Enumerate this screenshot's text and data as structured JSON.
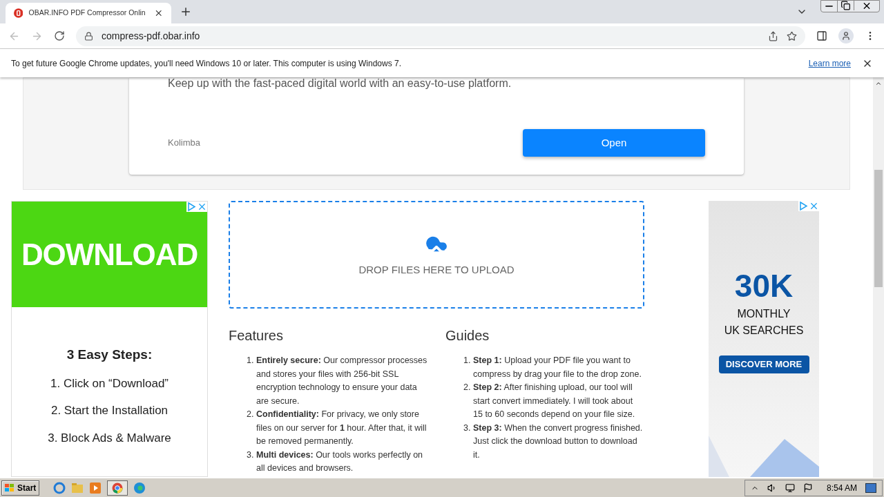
{
  "browser": {
    "tab": {
      "title": "OBAR.INFO PDF Compressor Onlin",
      "selected": true
    },
    "address": "compress-pdf.obar.info"
  },
  "infobar": {
    "message": "To get future Google Chrome updates, you'll need Windows 10 or later. This computer is using Windows 7.",
    "link": "Learn more"
  },
  "top_ad": {
    "text": "Keep up with the fast-paced digital world with an easy-to-use platform.",
    "brand": "Kolimba",
    "button": "Open"
  },
  "left_ad": {
    "headline": "DOWNLOAD",
    "subtitle": "3 Easy Steps:",
    "steps": [
      "1. Click on “Download”",
      "2. Start the Installation",
      "3. Block Ads & Malware"
    ]
  },
  "upload": {
    "label": "DROP FILES HERE TO UPLOAD"
  },
  "features": {
    "title": "Features",
    "items": [
      {
        "number": "1.",
        "text": "**Entirely secure:** Our compressor processes and stores your files with 256-bit SSL encryption technology to ensure your data are secure."
      },
      {
        "number": "2.",
        "text": "**Confidentiality:** For privacy, we only store files on our server for **1** hour. After that, it will be removed permanently."
      },
      {
        "number": "3.",
        "text": "**Multi devices:** Our tools works perfectly on all devices and browsers."
      }
    ]
  },
  "guides": {
    "title": "Guides",
    "items": [
      {
        "number": "1.",
        "text": "**Step 1:** Upload your PDF file you want to compress by drag your file to the drop zone."
      },
      {
        "number": "2.",
        "text": "**Step 2:** After finishing upload, our tool will start convert immediately. I will took about 15 to 60 seconds depend on your file size."
      },
      {
        "number": "3.",
        "text": "**Step 3:** When the convert progress finished. Just click the download button to download it."
      }
    ]
  },
  "right_ad": {
    "figure": "30K",
    "line1": "MONTHLY",
    "line2": "UK SEARCHES",
    "button": "DISCOVER MORE"
  },
  "taskbar": {
    "start": "Start",
    "clock": "8:54 AM"
  }
}
